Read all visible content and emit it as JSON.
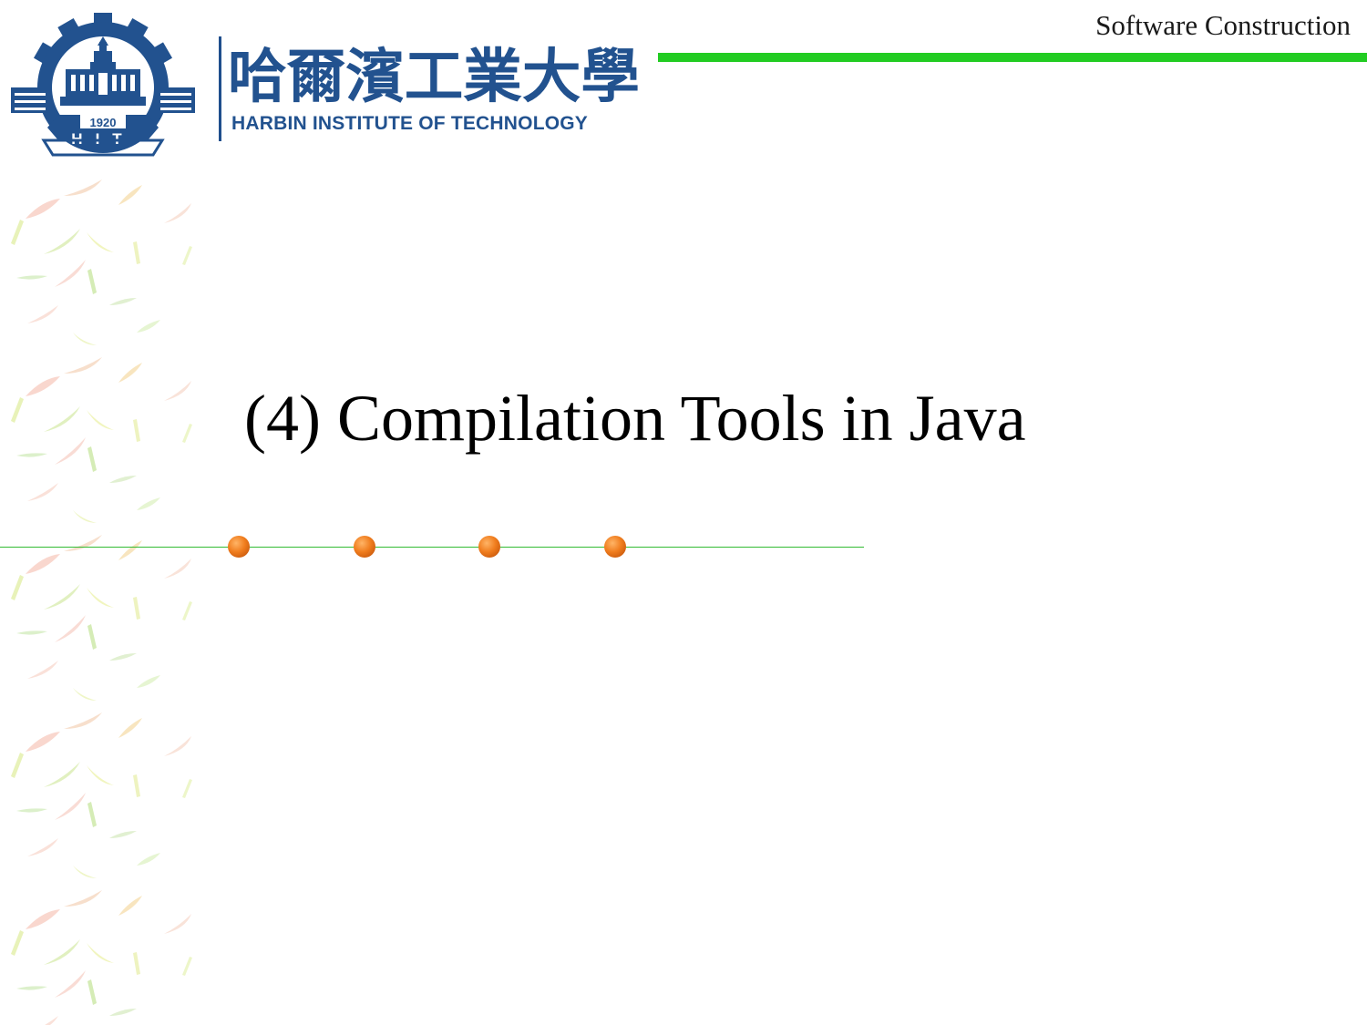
{
  "header": {
    "course_title": "Software Construction",
    "accent_color": "#22cc22"
  },
  "logo": {
    "emblem_year": "1920",
    "emblem_letters": "HIT",
    "name_chinese": "哈爾濱工業大學",
    "name_english": "HARBIN INSTITUTE OF TECHNOLOGY",
    "brand_color": "#22528f"
  },
  "slide": {
    "title": "(4) Compilation Tools in Java",
    "bullet_color": "#f07d1e"
  }
}
